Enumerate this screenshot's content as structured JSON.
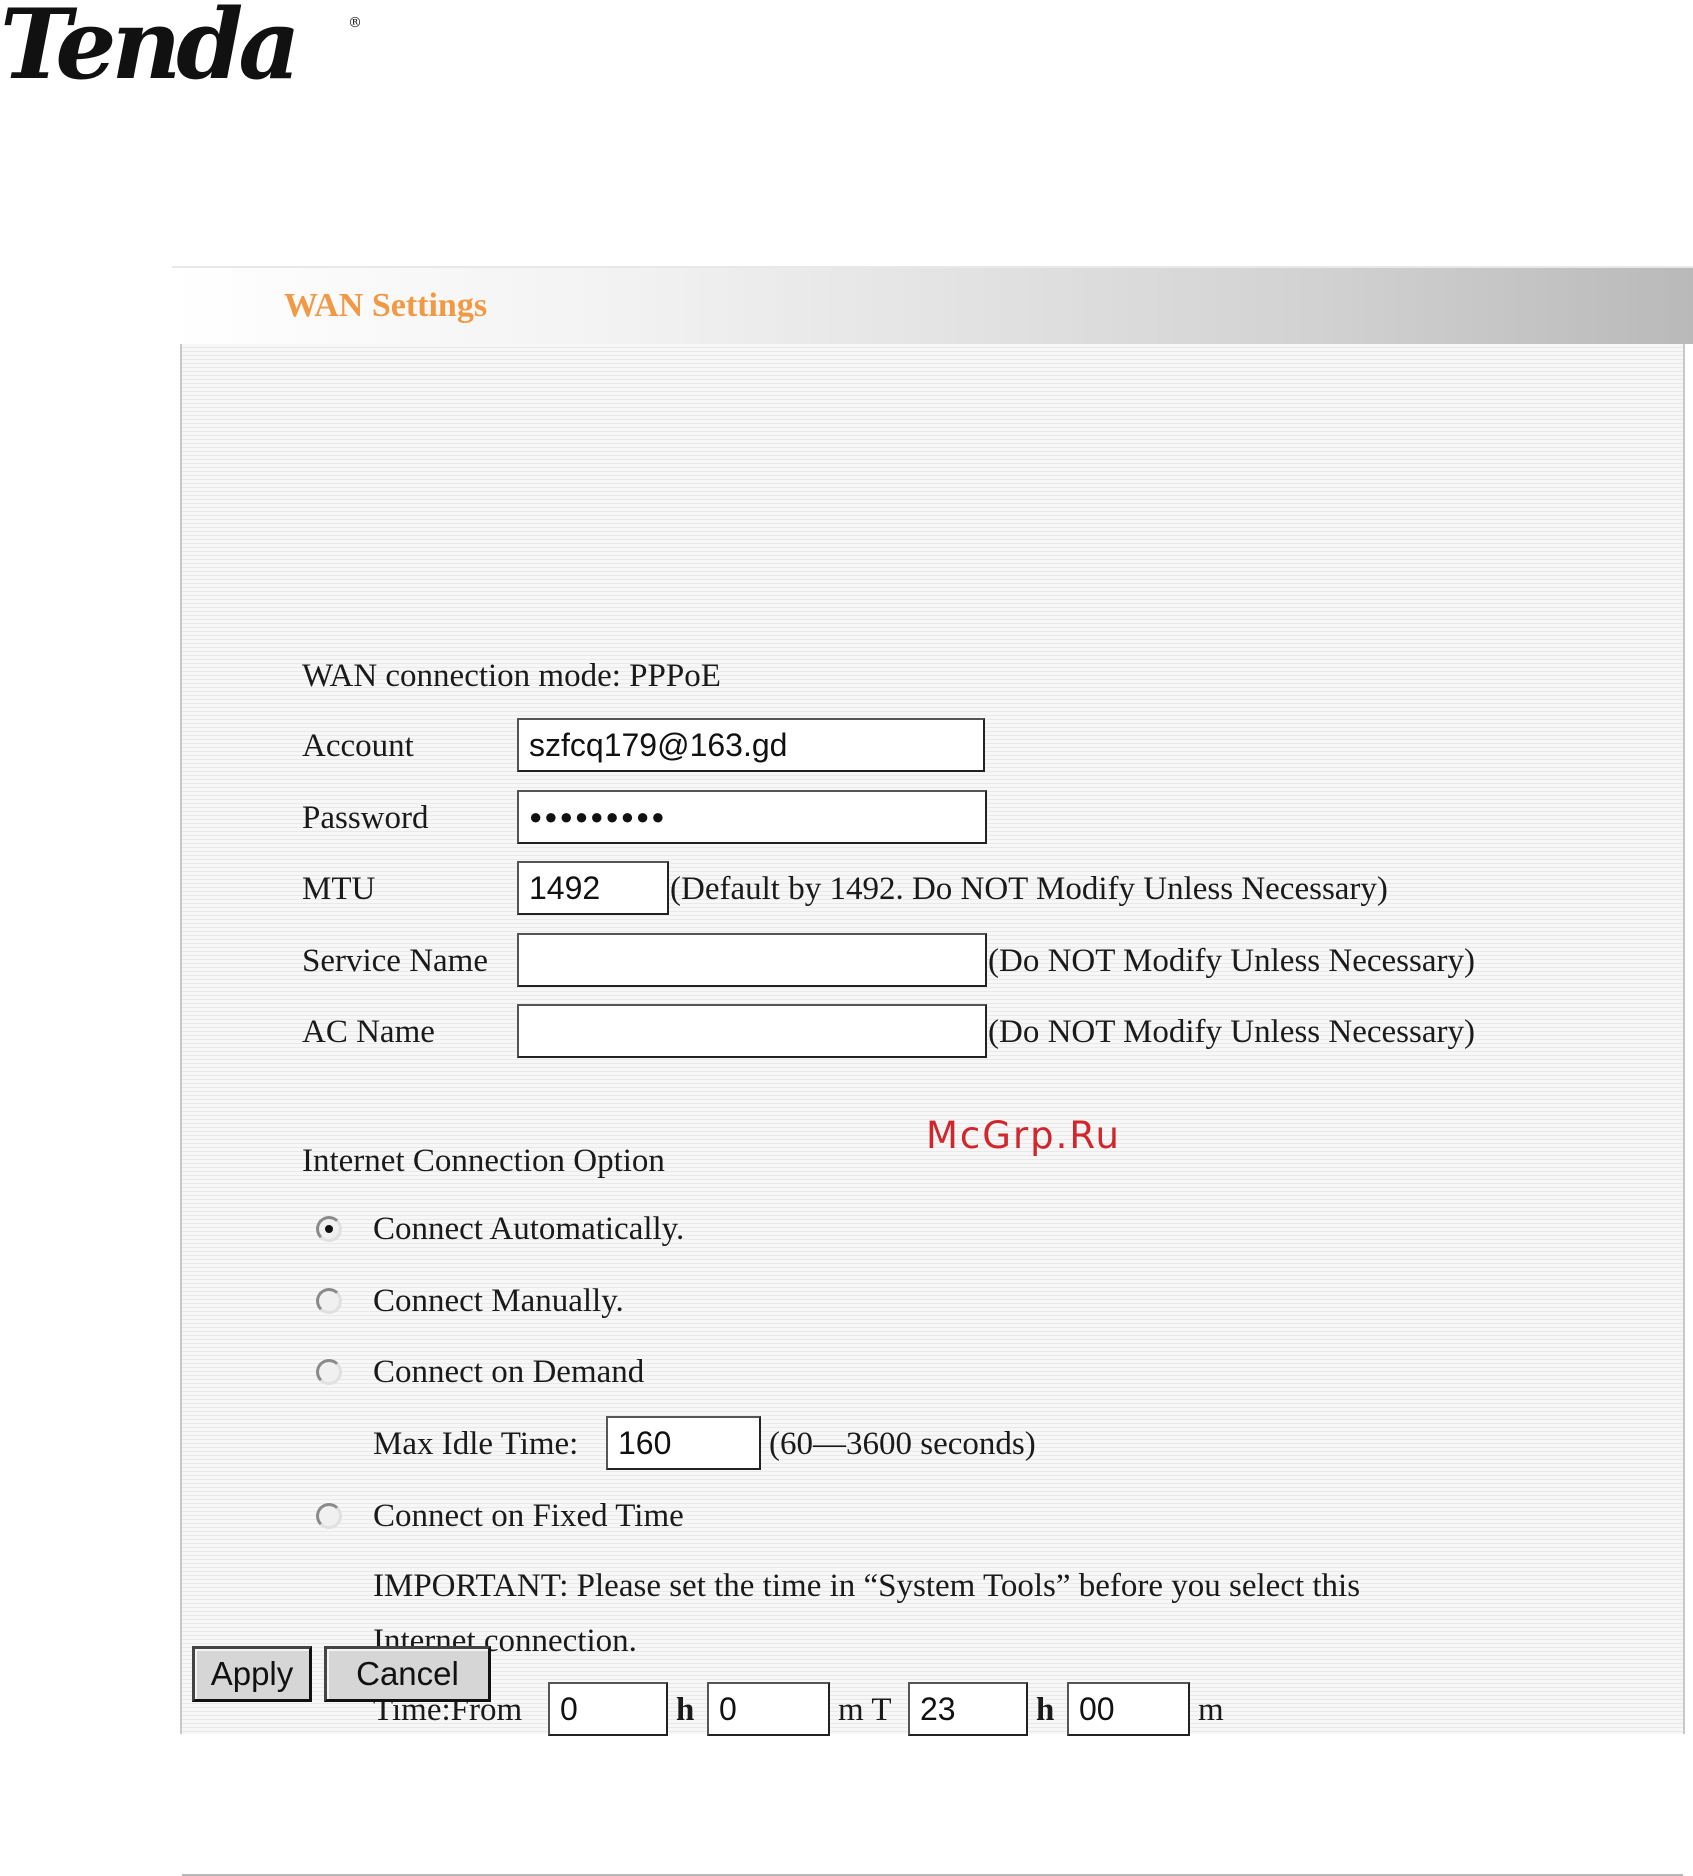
{
  "logo": {
    "text": "Tenda",
    "reg": "®"
  },
  "title": "WAN Settings",
  "wan": {
    "mode_label": "WAN connection mode: PPPoE",
    "account_label": "Account",
    "account_value": "szfcq179@163.gd",
    "password_label": "Password",
    "password_value": "●●●●●●●●●",
    "mtu_label": "MTU",
    "mtu_value": "1492",
    "mtu_note": "(Default by 1492. Do NOT Modify Unless Necessary)",
    "service_label": "Service Name",
    "service_value": "",
    "service_note": "(Do NOT Modify Unless Necessary)",
    "ac_label": "AC Name",
    "ac_value": "",
    "ac_note": "(Do NOT Modify Unless Necessary)"
  },
  "watermark": "McGrp.Ru",
  "option": {
    "heading": "Internet Connection Option",
    "auto_label": "Connect Automatically.",
    "auto_checked": true,
    "manual_label": "Connect Manually.",
    "manual_checked": false,
    "demand_label": "Connect on Demand",
    "demand_checked": false,
    "idle_label": "Max Idle Time:",
    "idle_value": "160",
    "idle_note": "(60—3600 seconds)",
    "fixed_label": "Connect on Fixed Time",
    "fixed_checked": false,
    "important_line1": "IMPORTANT: Please set the time in “System Tools” before you select this",
    "important_line2": "Internet connection.",
    "time_label": "Time:From",
    "from_h": "0",
    "h1": "h",
    "from_m": "0",
    "mt": "m T",
    "to_h": "23",
    "h2": "h",
    "to_m": "00",
    "m_end": "m"
  },
  "buttons": {
    "apply": "Apply",
    "cancel": "Cancel"
  },
  "colors": {
    "title": "#f19a45",
    "watermark": "#d0262c"
  }
}
